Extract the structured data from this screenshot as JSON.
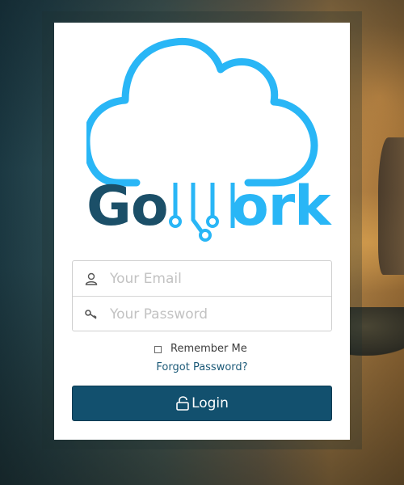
{
  "brand": {
    "name_part1": "Go",
    "name_part2": "ork",
    "colors": {
      "cloud": "#29b6f6",
      "text_dark": "#1b4f68",
      "text_light": "#29b6f6"
    }
  },
  "form": {
    "email": {
      "placeholder": "Your Email",
      "value": "",
      "icon": "user-icon"
    },
    "password": {
      "placeholder": "Your Password",
      "value": "",
      "icon": "key-icon"
    },
    "remember_label": "Remember Me",
    "remember_checked": false,
    "forgot_label": "Forgot Password?",
    "login_label": "Login",
    "login_icon": "unlock-icon"
  },
  "colors": {
    "button_bg": "#12506e",
    "link": "#1c5a78"
  }
}
